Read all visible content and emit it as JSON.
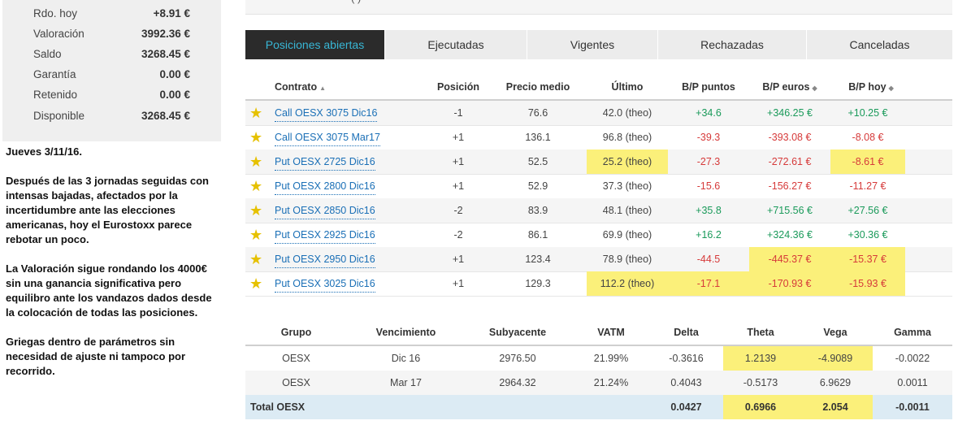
{
  "summary": [
    {
      "label": "Rdo. hoy",
      "value": "+8.91 €"
    },
    {
      "label": "Valoración",
      "value": "3992.36 €"
    },
    {
      "label": "Saldo",
      "value": "3268.45 €"
    },
    {
      "label": "Garantía",
      "value": "0.00 €"
    },
    {
      "label": "Retenido",
      "value": "0.00 €"
    },
    {
      "label": "Disponible",
      "value": "3268.45 €"
    }
  ],
  "note": {
    "p1": "Jueves 3/11/16.",
    "p2": "Después de las 3 jornadas seguidas con intensas bajadas, afectados por la incertidumbre ante las elecciones americanas, hoy el Eurostoxx parece rebotar un poco.",
    "p3": "La Valoración sigue rondando los 4000€ sin una ganancia significativa pero equilibro ante los vandazos dados desde la colocación de todas las posiciones.",
    "p4": "Griegas dentro de parámetros sin necesidad de ajuste ni tampoco por recorrido."
  },
  "top_strip_text": "(                                  )",
  "tabs": [
    "Posiciones abiertas",
    "Ejecutadas",
    "Vigentes",
    "Rechazadas",
    "Canceladas"
  ],
  "positions": {
    "headers": {
      "contrato": "Contrato",
      "posicion": "Posición",
      "precio_medio": "Precio medio",
      "ultimo": "Último",
      "bp_puntos": "B/P puntos",
      "bp_euros": "B/P euros",
      "bp_hoy": "B/P hoy"
    },
    "rows": [
      {
        "contrato": "Call OESX 3075 Dic16",
        "posicion": "-1",
        "precio": "76.6",
        "ultimo": "42.0 (theo)",
        "puntos": "+34.6",
        "euros": "+346.25 €",
        "hoy": "+10.25 €"
      },
      {
        "contrato": "Call OESX 3075 Mar17",
        "posicion": "+1",
        "precio": "136.1",
        "ultimo": "96.8 (theo)",
        "puntos": "-39.3",
        "euros": "-393.08 €",
        "hoy": "-8.08 €"
      },
      {
        "contrato": "Put OESX 2725 Dic16",
        "posicion": "+1",
        "precio": "52.5",
        "ultimo": "25.2 (theo)",
        "puntos": "-27.3",
        "euros": "-272.61 €",
        "hoy": "-8.61 €"
      },
      {
        "contrato": "Put OESX 2800 Dic16",
        "posicion": "+1",
        "precio": "52.9",
        "ultimo": "37.3 (theo)",
        "puntos": "-15.6",
        "euros": "-156.27 €",
        "hoy": "-11.27 €"
      },
      {
        "contrato": "Put OESX 2850 Dic16",
        "posicion": "-2",
        "precio": "83.9",
        "ultimo": "48.1 (theo)",
        "puntos": "+35.8",
        "euros": "+715.56 €",
        "hoy": "+27.56 €"
      },
      {
        "contrato": "Put OESX 2925 Dic16",
        "posicion": "-2",
        "precio": "86.1",
        "ultimo": "69.9 (theo)",
        "puntos": "+16.2",
        "euros": "+324.36 €",
        "hoy": "+30.36 €"
      },
      {
        "contrato": "Put OESX 2950 Dic16",
        "posicion": "+1",
        "precio": "123.4",
        "ultimo": "78.9 (theo)",
        "puntos": "-44.5",
        "euros": "-445.37 €",
        "hoy": "-15.37 €"
      },
      {
        "contrato": "Put OESX 3025 Dic16",
        "posicion": "+1",
        "precio": "129.3",
        "ultimo": "112.2 (theo)",
        "puntos": "-17.1",
        "euros": "-170.93 €",
        "hoy": "-15.93 €"
      }
    ]
  },
  "greeks": {
    "headers": {
      "grupo": "Grupo",
      "vencimiento": "Vencimiento",
      "subyacente": "Subyacente",
      "vatm": "VATM",
      "delta": "Delta",
      "theta": "Theta",
      "vega": "Vega",
      "gamma": "Gamma"
    },
    "rows": [
      {
        "grupo": "OESX",
        "vencimiento": "Dic 16",
        "subyacente": "2976.50",
        "vatm": "21.99%",
        "delta": "-0.3616",
        "theta": "1.2139",
        "vega": "-4.9089",
        "gamma": "-0.0022"
      },
      {
        "grupo": "OESX",
        "vencimiento": "Mar 17",
        "subyacente": "2964.32",
        "vatm": "21.24%",
        "delta": "0.4043",
        "theta": "-0.5173",
        "vega": "6.9629",
        "gamma": "0.0011"
      }
    ],
    "total": {
      "label": "Total OESX",
      "delta": "0.0427",
      "theta": "0.6966",
      "vega": "2.054",
      "gamma": "-0.0011"
    }
  },
  "colors": {
    "positive": "#1a9a5a",
    "negative": "#d63a3a",
    "highlight": "#fbf07a",
    "tab_active_bg": "#2b2b2b",
    "tab_active_text": "#38b7d6",
    "total_bg": "#dcebf4"
  }
}
